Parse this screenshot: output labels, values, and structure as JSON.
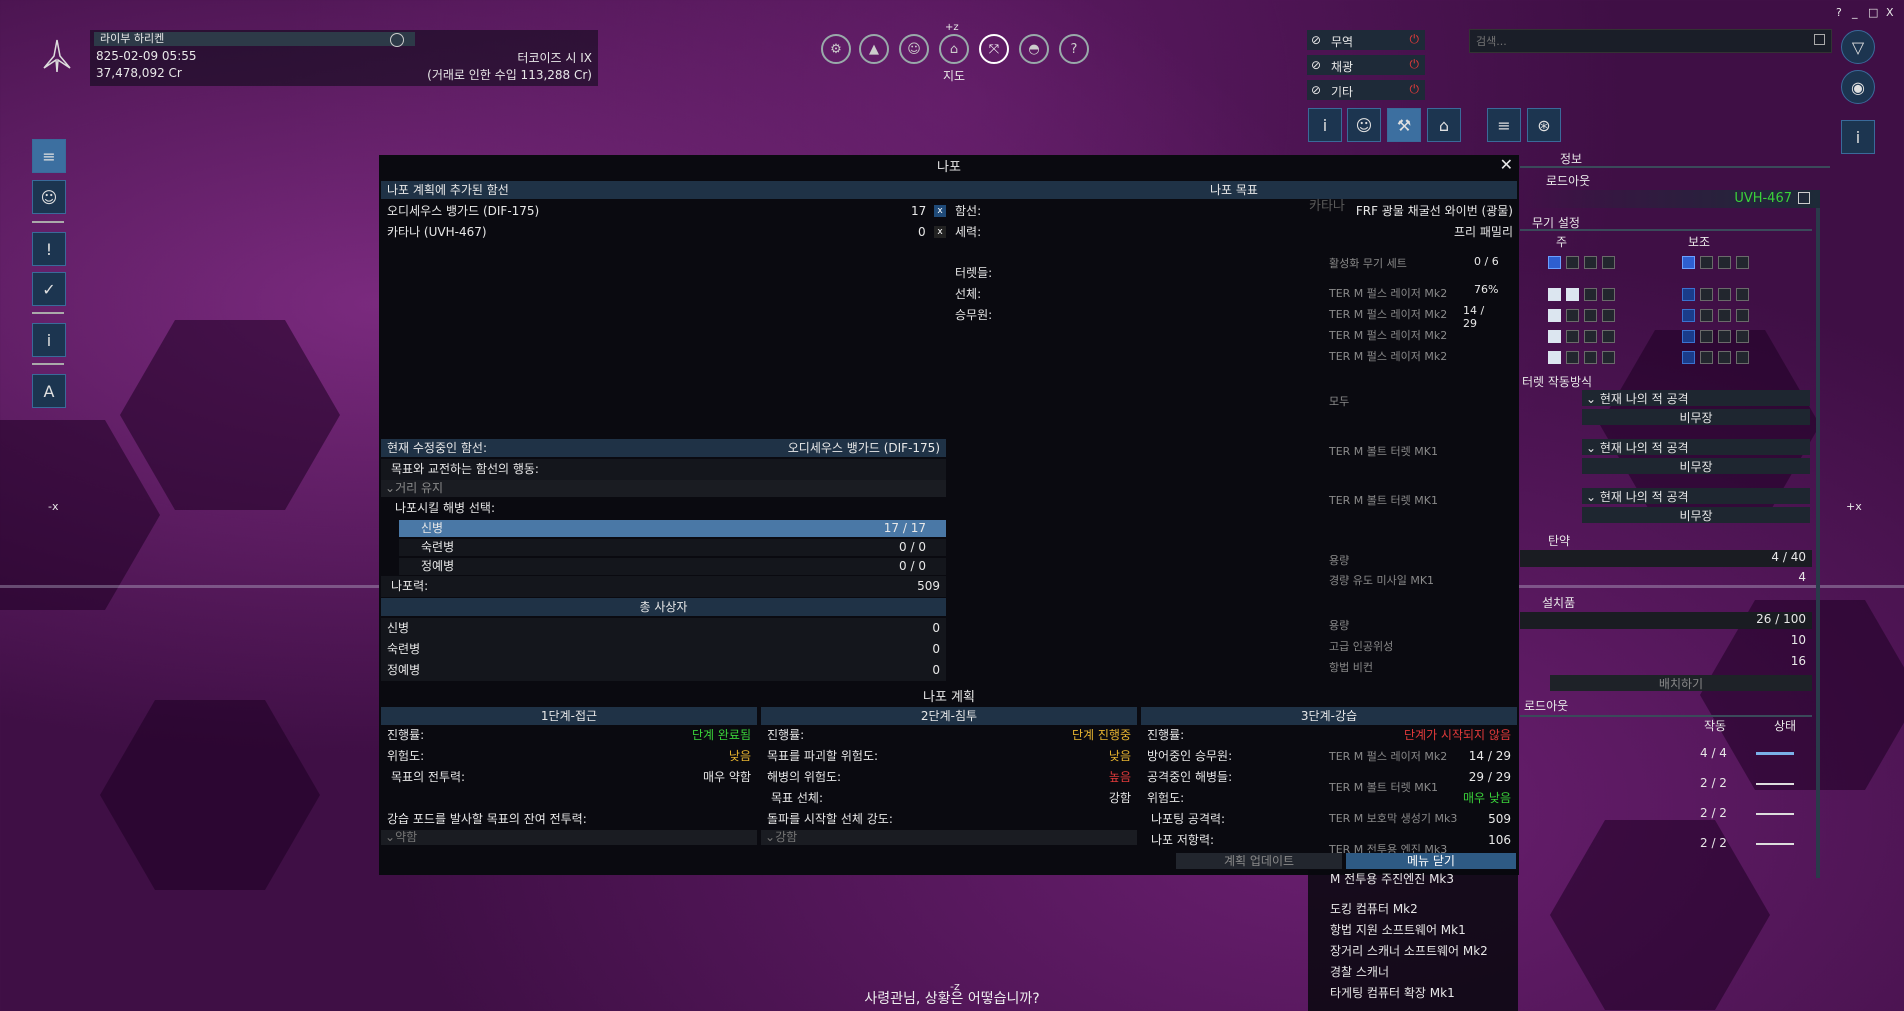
{
  "colors": {
    "accent": "#3c6fa0",
    "bg": "#3f0f45",
    "panel": "#0a0a10",
    "ok": "#3ad23a",
    "warn": "#e6b330",
    "bad": "#e23a3a"
  },
  "player": {
    "name": "라이부 하리켄",
    "date": "825-02-09 05:55",
    "credits": "37,478,092 Cr",
    "location": "터코이즈 시 IX",
    "income": "(거래로 인한 수입 113,288 Cr)"
  },
  "topnav": {
    "icons": [
      "gear-icon",
      "triangle-icon",
      "person-icon",
      "ship-icon",
      "map-icon",
      "dome-icon",
      "help-icon"
    ],
    "z_label": "+z",
    "active_label": "지도"
  },
  "left_sidebar": [
    "menu-icon",
    "profile-icon",
    "alert-icon",
    "mission-icon",
    "info-icon",
    "navigate-icon"
  ],
  "axis": {
    "minus_x": "-x",
    "plus_x": "+x",
    "minus_z": "-z"
  },
  "filters": [
    {
      "label": "무역"
    },
    {
      "label": "채광"
    },
    {
      "label": "기타"
    }
  ],
  "search": {
    "placeholder": "검색..."
  },
  "window_controls": [
    "?",
    "_",
    "□",
    "X"
  ],
  "panel": {
    "title": "나포",
    "left_header": "나포 계획에 추가된 함선",
    "ships": [
      {
        "name": "오디세우스 뱅가드 (DIF-175)",
        "value": "17"
      },
      {
        "name": "카타나 (UVH-467)",
        "value": "0"
      }
    ],
    "right_header": "나포 목표",
    "target": {
      "ship_label": "함선:",
      "ship_value": "FRF 광물 채굴선 와이번 (광물)",
      "faction_label": "세력:",
      "faction_value": "프리 패밀리",
      "turrets_label": "터렛들:",
      "hull_label": "선체:",
      "crew_label": "승무원:"
    },
    "current": {
      "label": "현재 수정중인 함선:",
      "value": "오디세우스 뱅가드 (DIF-175)"
    },
    "behavior_label": "목표와 교전하는 함선의 행동:",
    "behavior_value": "거리 유지",
    "marines_label": "나포시킬 해병 선택:",
    "marines": [
      {
        "rank": "신병",
        "count": "17 / 17"
      },
      {
        "rank": "숙련병",
        "count": "0 / 0"
      },
      {
        "rank": "정예병",
        "count": "0 / 0"
      }
    ],
    "strength_label": "나포력:",
    "strength_value": "509",
    "casualties_header": "총 사상자",
    "casualties": [
      {
        "rank": "신병",
        "count": "0"
      },
      {
        "rank": "숙련병",
        "count": "0"
      },
      {
        "rank": "정예병",
        "count": "0"
      }
    ],
    "plan_title": "나포 계획",
    "phases": [
      {
        "title": "1단계-접근",
        "rows": [
          {
            "k": "진행률:",
            "v": "단계 완료됨",
            "c": "green"
          },
          {
            "k": "위험도:",
            "v": "낮음",
            "c": "yellow"
          },
          {
            "k": "목표의 전투력:",
            "v": "매우 약함",
            "c": "white"
          }
        ],
        "foot_label": "강습 포드를 발사할 목표의 잔여 전투력:",
        "foot_value": "약함"
      },
      {
        "title": "2단계-침투",
        "rows": [
          {
            "k": "진행률:",
            "v": "단계 진행중",
            "c": "yellow"
          },
          {
            "k": "목표를 파괴할 위험도:",
            "v": "낮음",
            "c": "yellow"
          },
          {
            "k": "해병의 위험도:",
            "v": "높음",
            "c": "red"
          },
          {
            "k": "목표 선체:",
            "v": "강함",
            "c": "white"
          }
        ],
        "foot_label": "돌파를 시작할 선체 강도:",
        "foot_value": "강함"
      },
      {
        "title": "3단계-강습",
        "rows": [
          {
            "k": "진행률:",
            "v": "단계가 시작되지 않음",
            "c": "red"
          },
          {
            "k": "방어중인 승무원:",
            "v": "14 / 29",
            "c": "white"
          },
          {
            "k": "공격중인 해병들:",
            "v": "29 / 29",
            "c": "white"
          },
          {
            "k": "위험도:",
            "v": "매우 낮음",
            "c": "green"
          },
          {
            "k": "나포팅 공격력:",
            "v": "509",
            "c": "white"
          },
          {
            "k": "나포 저항력:",
            "v": "106",
            "c": "white"
          }
        ]
      }
    ],
    "update_btn": "계획 업데이트",
    "close_btn": "메뉴 닫기",
    "overlay": {
      "katana": "카타나",
      "weapon_set_label": "활성화 무기 세트",
      "weapon_set_value": "0 / 6",
      "lasers": [
        "TER M 펄스 레이저 Mk2",
        "TER M 펄스 레이저 Mk2",
        "TER M 펄스 레이저 Mk2",
        "TER M 펄스 레이저 Mk2"
      ],
      "laser_vals": [
        "76%",
        "14 / 29"
      ],
      "all": "모두",
      "bolts": [
        "TER M 볼트 터렛 MK1",
        "TER M 볼트 터렛 MK1"
      ],
      "cap1": "용량",
      "missile": "경량 유도 미사일 MK1",
      "cap2": "용량",
      "drones": [
        "고급 인공위성",
        "항법 비컨"
      ],
      "bottom": [
        "TER M 펄스 레이저 Mk2",
        "TER M 볼트 터렛 MK1",
        "TER M 보호막 생성기 Mk3",
        "TER M 전투용 엔진 Mk3"
      ]
    }
  },
  "right_panel": {
    "tabs_header": "정보",
    "loadout_label": "로드아웃",
    "ship_id": "UVH-467",
    "weapon_config": "무기 설정",
    "primary": "주",
    "secondary": "보조",
    "turret_behavior": "터렛 작동방식",
    "turret_groups": [
      {
        "mode": "현재 나의 적 공격",
        "sub": "비무장"
      },
      {
        "mode": "현재 나의 적 공격",
        "sub": "비무장"
      },
      {
        "mode": "현재 나의 적 공격",
        "sub": "비무장"
      }
    ],
    "ammo": "탄약",
    "ammo_vals": [
      "4 / 40",
      "4"
    ],
    "deployables": "설치품",
    "deploy_vals": [
      "26 / 100",
      "10",
      "16"
    ],
    "deploy_btn": "배치하기",
    "loadout2": "로드아웃",
    "col_op": "작동",
    "col_state": "상태",
    "loadout_rows": [
      "4 / 4",
      "2 / 2",
      "2 / 2",
      "2 / 2"
    ]
  },
  "equipment_list": [
    "M 전투용 주진엔진 Mk3",
    "도킹 컴퓨터 Mk2",
    "항법 지원 소프트웨어 Mk1",
    "장거리 스캐너 소프트웨어 Mk2",
    "경찰 스캐너",
    "타게팅 컴퓨터 확장 Mk1"
  ],
  "subtitle": "사령관님, 상황은 어떻습니까?"
}
